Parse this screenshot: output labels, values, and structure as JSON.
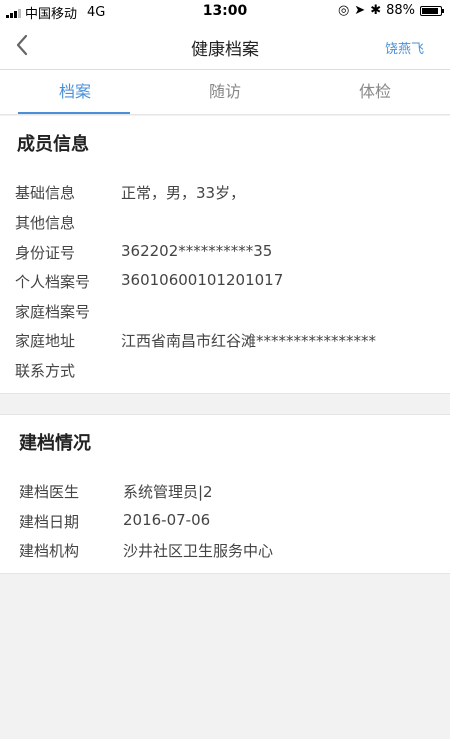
{
  "status_bar": {
    "carrier": "中国移动",
    "network": "4G",
    "time": "13:00",
    "battery_percent": "88%",
    "battery_level": 0.88
  },
  "nav": {
    "title": "健康档案",
    "user": "饶燕飞"
  },
  "tabs": [
    {
      "label": "档案",
      "active": true
    },
    {
      "label": "随访",
      "active": false
    },
    {
      "label": "体检",
      "active": false
    }
  ],
  "member_info": {
    "title": "成员信息",
    "rows": [
      {
        "label": "基础信息",
        "value": "正常，男，33岁，"
      },
      {
        "label": "其他信息",
        "value": ""
      },
      {
        "label": "身份证号",
        "value": "362202**********35"
      },
      {
        "label": "个人档案号",
        "value": "36010600101201017"
      },
      {
        "label": "家庭档案号",
        "value": ""
      },
      {
        "label": "家庭地址",
        "value": "江西省南昌市红谷滩****************"
      },
      {
        "label": "联系方式",
        "value": ""
      }
    ]
  },
  "archive_info": {
    "title": "建档情况",
    "rows": [
      {
        "label": "建档医生",
        "value": "系统管理员|2"
      },
      {
        "label": "建档日期",
        "value": "2016-07-06"
      },
      {
        "label": "建档机构",
        "value": "沙井社区卫生服务中心"
      }
    ]
  },
  "colors": {
    "accent": "#4a90d9",
    "background": "#f2f2f2"
  }
}
